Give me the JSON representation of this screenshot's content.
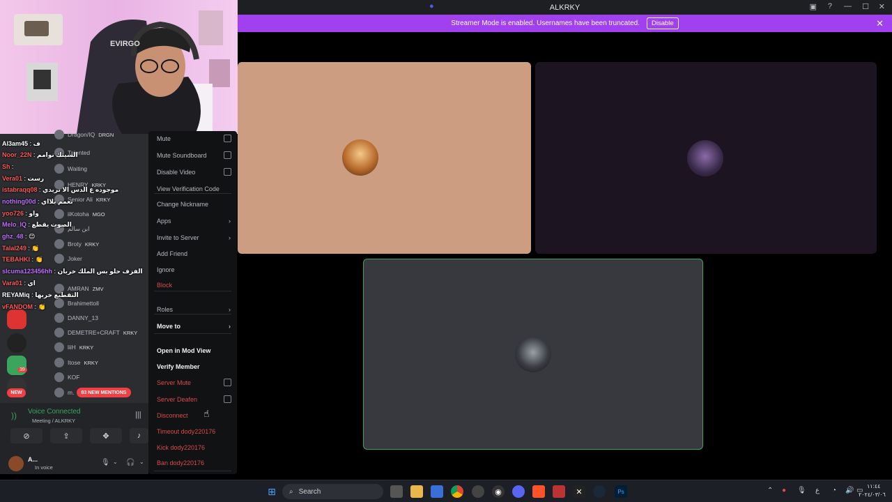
{
  "window": {
    "title": "ALKRKY"
  },
  "banner": {
    "text": "Streamer Mode is enabled. Usernames have been truncated.",
    "button": "Disable"
  },
  "context_menu": {
    "items": [
      {
        "label": "Mute",
        "style": "gray",
        "checkbox": true
      },
      {
        "label": "Mute Soundboard",
        "style": "gray",
        "checkbox": true
      },
      {
        "label": "Disable Video",
        "style": "gray",
        "checkbox": true
      },
      {
        "label": "View Verification Code",
        "style": "gray"
      },
      {
        "label": "Change Nickname",
        "style": "gray"
      },
      {
        "label": "Apps",
        "style": "gray",
        "submenu": true
      },
      {
        "label": "Invite to Server",
        "style": "gray",
        "submenu": true
      },
      {
        "label": "Add Friend",
        "style": "gray"
      },
      {
        "label": "Ignore",
        "style": "gray"
      },
      {
        "label": "Block",
        "style": "red"
      },
      {
        "label": "Roles",
        "style": "gray",
        "submenu": true
      },
      {
        "label": "Move to",
        "style": "white",
        "submenu": true
      },
      {
        "label": "Open in Mod View",
        "style": "white"
      },
      {
        "label": "Verify Member",
        "style": "white"
      },
      {
        "label": "Server Mute",
        "style": "red",
        "checkbox": true
      },
      {
        "label": "Server Deafen",
        "style": "red",
        "checkbox": true
      },
      {
        "label": "Disconnect",
        "style": "red"
      },
      {
        "label": "Timeout dody220176",
        "style": "red"
      },
      {
        "label": "Kick dody220176",
        "style": "red"
      },
      {
        "label": "Ban dody220176",
        "style": "red"
      }
    ]
  },
  "members": [
    {
      "name": "Dragon/IQ",
      "tag": "DRGN"
    },
    {
      "name": "Talented",
      "tag": ""
    },
    {
      "name": "Waiting",
      "tag": ""
    },
    {
      "name": "HENRY",
      "tag": "KRKY"
    },
    {
      "name": "Senior Ali",
      "tag": "KRKY"
    },
    {
      "name": "iiKotoha",
      "tag": "MGO"
    },
    {
      "name": "ابن سالم",
      "tag": ""
    },
    {
      "name": "Broty",
      "tag": "KRKY"
    },
    {
      "name": "Joker",
      "tag": ""
    },
    {
      "name": "",
      "tag": ""
    },
    {
      "name": "AMRAN",
      "tag": "ZMV"
    },
    {
      "name": "Brahimettoll",
      "tag": ""
    },
    {
      "name": "DANNY_13",
      "tag": ""
    },
    {
      "name": "DEMETRE+CRAFT",
      "tag": "KRKY"
    },
    {
      "name": "liiH",
      "tag": "KRKY"
    },
    {
      "name": "Itose",
      "tag": "KRKY"
    },
    {
      "name": "KOF",
      "tag": ""
    },
    {
      "name": "m.",
      "tag": ""
    }
  ],
  "chat": [
    {
      "user": "Al3am45",
      "msg": "ف",
      "color": "#ffffff"
    },
    {
      "user": "Noor_22N",
      "msg": "السيتك نوامم",
      "color": "#ff5a5a"
    },
    {
      "user": "Sh",
      "msg": "",
      "color": "#ff5a5a"
    },
    {
      "user": "Vera01",
      "msg": "رست",
      "color": "#ff5a5a"
    },
    {
      "user": "istabraqq08",
      "msg": "موجوده ع الدس الا تريدي",
      "color": "#ff5a5a"
    },
    {
      "user": "nothing00d",
      "msg": "نعمم بلااي",
      "color": "#c070ff"
    },
    {
      "user": "yoo726",
      "msg": "واو",
      "color": "#ff5a5a"
    },
    {
      "user": "Melo_IQ",
      "msg": "الصوت يقطع",
      "color": "#c070ff"
    },
    {
      "user": "ghz_48",
      "msg": "😊",
      "color": "#c070ff"
    },
    {
      "user": "Talal249",
      "msg": "👏",
      "color": "#ff5a5a"
    },
    {
      "user": "TEBAHKI",
      "msg": "👏",
      "color": "#ff5a5a"
    },
    {
      "user": "slcuma123456hh",
      "msg": "الفزف حلو بس الملك خربان",
      "color": "#c070ff"
    },
    {
      "user": "Vara01",
      "msg": "اي",
      "color": "#ff5a5a"
    },
    {
      "user": "REYAMiq",
      "msg": "التقطيع خربها",
      "color": "#ffffff"
    },
    {
      "user": "vFANDOM",
      "msg": "👏",
      "color": "#ff5a5a"
    }
  ],
  "badges": {
    "new": "NEW",
    "mentions": "83 NEW MENTIONS",
    "server_count": "39"
  },
  "voice": {
    "status": "Voice Connected",
    "channel": "Meeting / ALKRKY"
  },
  "user_panel": {
    "name": "A...",
    "status": "In voice"
  },
  "taskbar": {
    "search_placeholder": "Search",
    "time": "١١:٤٤",
    "date": "٢٠٢٤/٠٣/٠٦",
    "lang": "ع"
  },
  "colors": {
    "banner": "#a040ee",
    "speaking_border": "#3ba55d",
    "danger": "#f23f43",
    "tile_left": "#cc9d80",
    "tile_right": "#1c1420",
    "tile_bottom": "#37393f"
  }
}
